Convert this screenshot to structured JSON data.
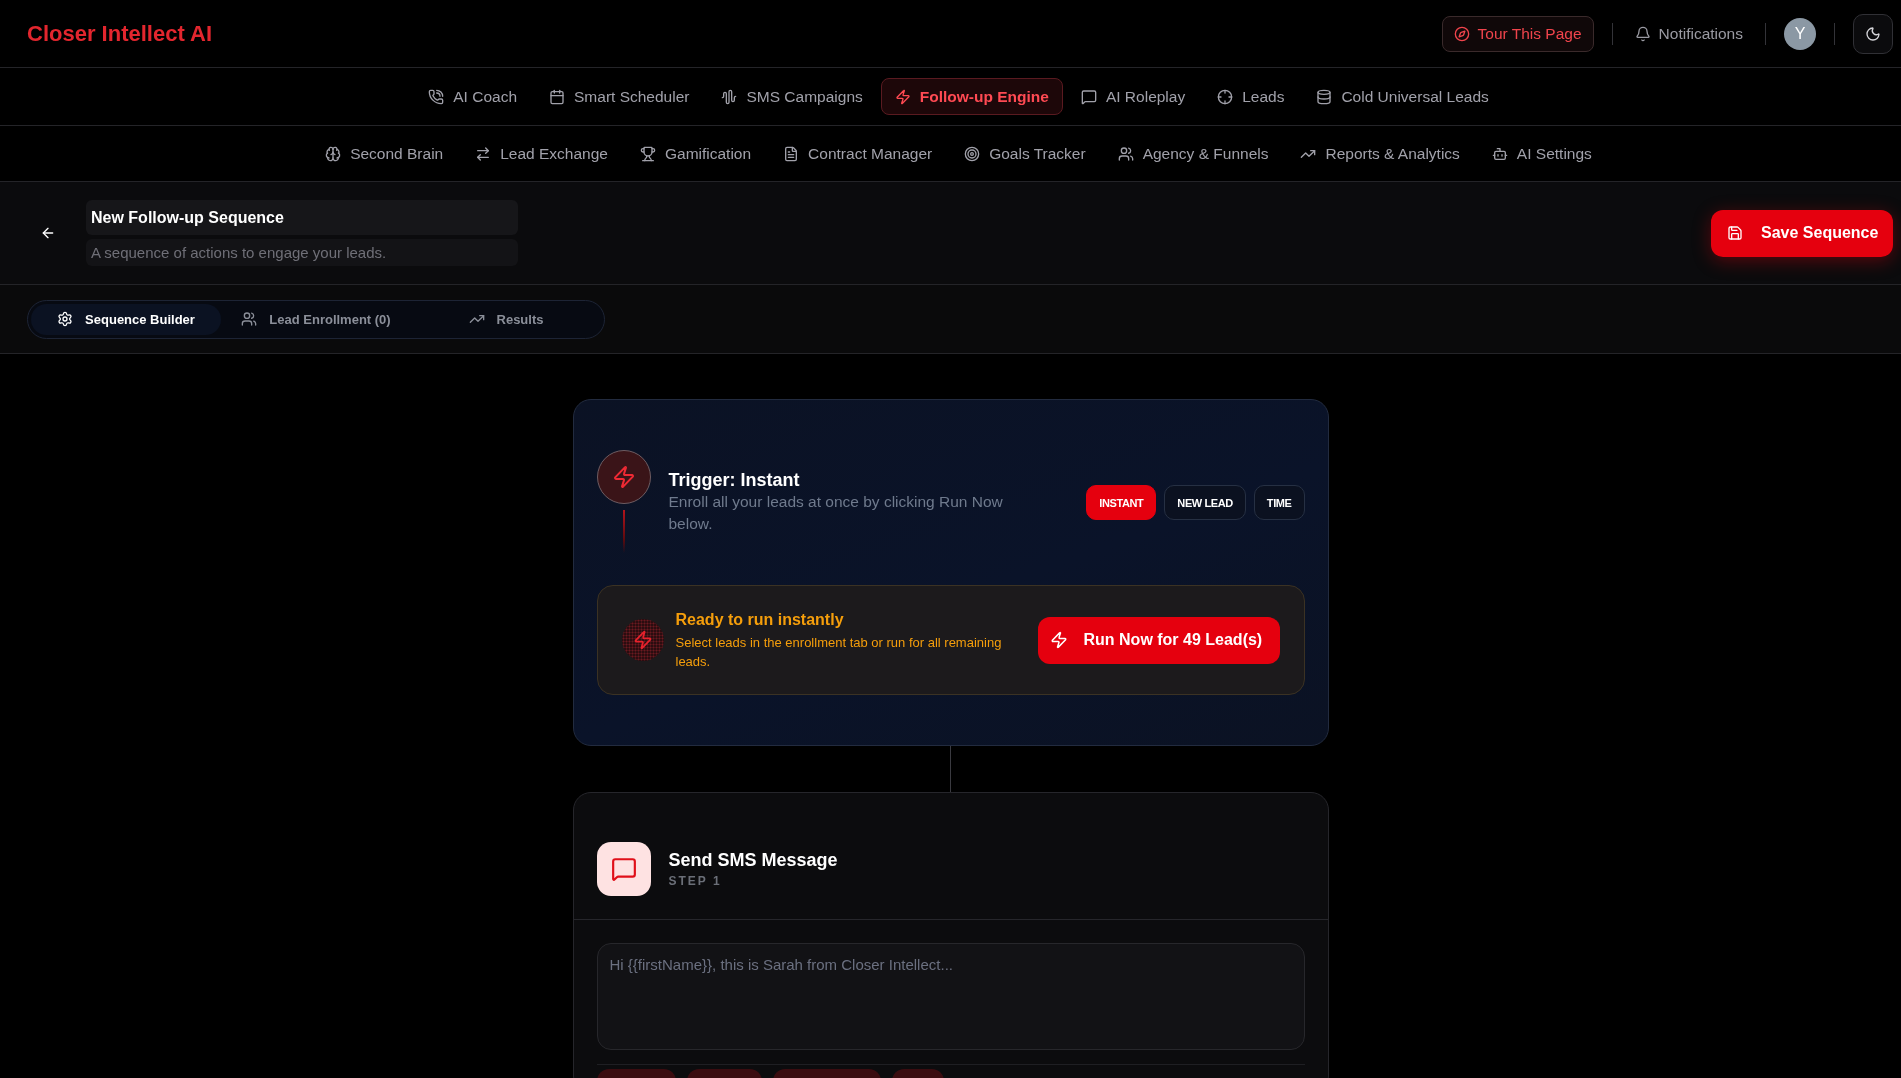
{
  "app": {
    "logo": "Closer Intellect AI"
  },
  "header_actions": {
    "tour_button": "Tour This Page",
    "notifications": "Notifications",
    "avatar": "Y"
  },
  "nav_primary": [
    {
      "label": "AI Coach",
      "selected": false
    },
    {
      "label": "Smart Scheduler",
      "selected": false
    },
    {
      "label": "SMS Campaigns",
      "selected": false
    },
    {
      "label": "Follow-up Engine",
      "selected": true
    },
    {
      "label": "AI Roleplay",
      "selected": false
    },
    {
      "label": "Leads",
      "selected": false
    },
    {
      "label": "Cold Universal Leads",
      "selected": false
    }
  ],
  "nav_secondary": [
    {
      "label": "Second Brain",
      "selected": false
    },
    {
      "label": "Lead Exchange",
      "selected": false
    },
    {
      "label": "Gamification",
      "selected": false
    },
    {
      "label": "Contract Manager",
      "selected": false
    },
    {
      "label": "Goals Tracker",
      "selected": false
    },
    {
      "label": "Agency & Funnels",
      "selected": false
    },
    {
      "label": "Reports & Analytics",
      "selected": false
    },
    {
      "label": "AI Settings",
      "selected": false
    }
  ],
  "sequence": {
    "title": {
      "value": "New Follow-up Sequence"
    },
    "description": {
      "value": "A sequence of actions to engage your leads."
    },
    "save_button": "Save Sequence"
  },
  "tabs": [
    {
      "label": "Sequence Builder",
      "selected": true
    },
    {
      "label": "Lead Enrollment (0)",
      "selected": false
    },
    {
      "label": "Results",
      "selected": false
    }
  ],
  "trigger": {
    "title": "Trigger: Instant",
    "description": "Enroll all your leads at once by clicking Run Now below.",
    "options": [
      {
        "label": "INSTANT",
        "selected": true
      },
      {
        "label": "NEW LEAD",
        "selected": false
      },
      {
        "label": "TIME",
        "selected": false
      }
    ],
    "ready": {
      "title": "Ready to run instantly",
      "description": "Select leads in the enrollment tab or run for all remaining leads.",
      "button": "Run Now for 49 Lead(s)"
    }
  },
  "steps": [
    {
      "kind": "sms",
      "title": "Send SMS Message",
      "step_label": "STEP 1",
      "message": {
        "placeholder": "Hi {{firstName}}, this is Sarah from Closer Intellect..."
      }
    }
  ]
}
